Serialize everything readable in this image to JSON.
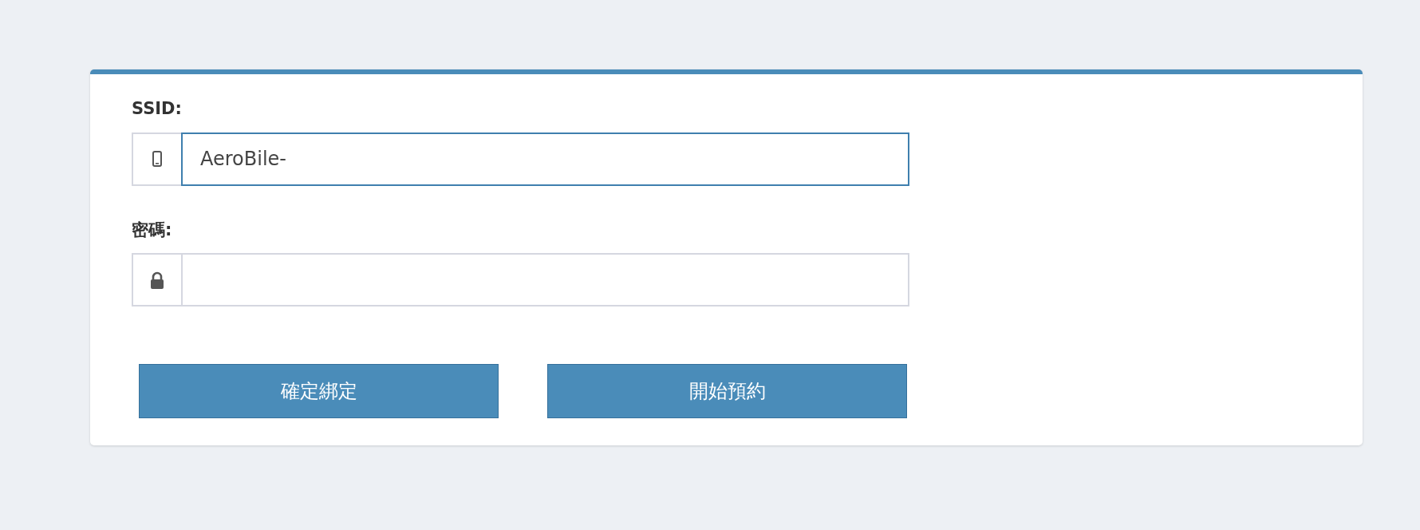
{
  "fields": [
    {
      "kind": "text",
      "label": "SSID:",
      "value": "AeroBile-",
      "focused": true
    },
    {
      "kind": "password",
      "label": "密碼:",
      "focused": false
    }
  ],
  "buttons": [
    "確定綁定",
    "開始預約"
  ]
}
